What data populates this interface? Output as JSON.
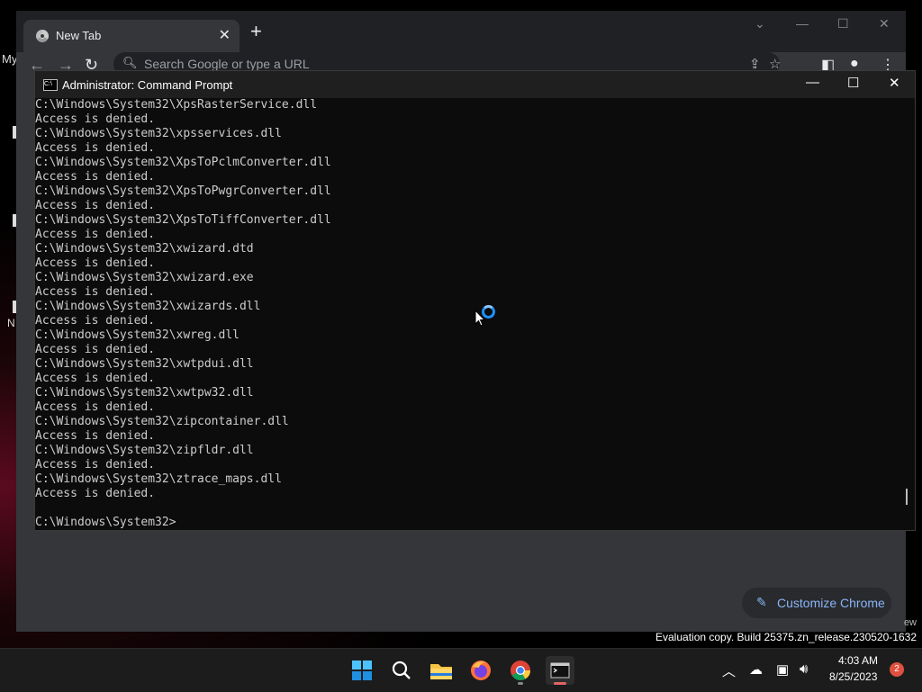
{
  "desktop": {
    "label": "My",
    "letter": "N"
  },
  "chrome": {
    "tab_title": "New Tab",
    "tab_close": "✕",
    "new_tab": "+",
    "omnibox_placeholder": "Search Google or type a URL",
    "customize_label": "Customize Chrome"
  },
  "cmd": {
    "title": "Administrator: Command Prompt",
    "lines": [
      "C:\\Windows\\System32\\XpsRasterService.dll",
      "Access is denied.",
      "C:\\Windows\\System32\\xpsservices.dll",
      "Access is denied.",
      "C:\\Windows\\System32\\XpsToPclmConverter.dll",
      "Access is denied.",
      "C:\\Windows\\System32\\XpsToPwgrConverter.dll",
      "Access is denied.",
      "C:\\Windows\\System32\\XpsToTiffConverter.dll",
      "Access is denied.",
      "C:\\Windows\\System32\\xwizard.dtd",
      "Access is denied.",
      "C:\\Windows\\System32\\xwizard.exe",
      "Access is denied.",
      "C:\\Windows\\System32\\xwizards.dll",
      "Access is denied.",
      "C:\\Windows\\System32\\xwreg.dll",
      "Access is denied.",
      "C:\\Windows\\System32\\xwtpdui.dll",
      "Access is denied.",
      "C:\\Windows\\System32\\xwtpw32.dll",
      "Access is denied.",
      "C:\\Windows\\System32\\zipcontainer.dll",
      "Access is denied.",
      "C:\\Windows\\System32\\zipfldr.dll",
      "Access is denied.",
      "C:\\Windows\\System32\\ztrace_maps.dll",
      "Access is denied.",
      "",
      "C:\\Windows\\System32>"
    ]
  },
  "watermark": {
    "ew": "ew",
    "text": "Evaluation copy. Build 25375.zn_release.230520-1632"
  },
  "taskbar": {
    "time": "4:03 AM",
    "date": "8/25/2023",
    "notifications": "2"
  },
  "colors": {
    "accent": "#8ab4f8",
    "busy_ring": "#1e90ff",
    "badge": "#e05040"
  }
}
